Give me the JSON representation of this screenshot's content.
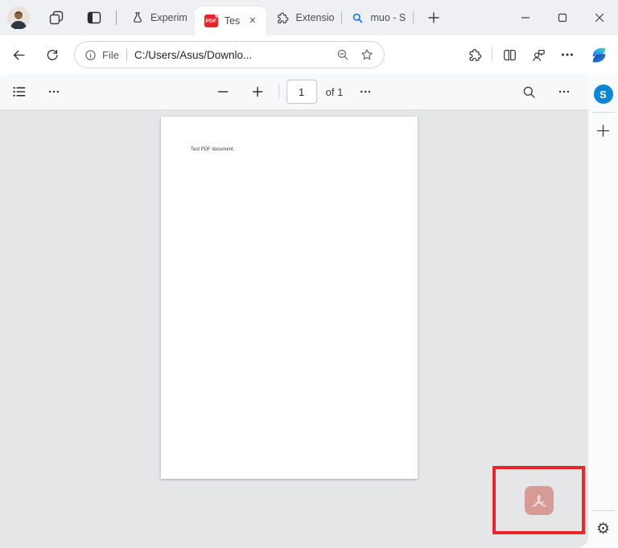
{
  "tab_strip": {
    "tabs": [
      {
        "label": "Experim"
      },
      {
        "label": "Tes"
      },
      {
        "label": "Extensio"
      },
      {
        "label": "muo - S"
      }
    ],
    "active_tab_index": 1,
    "pdf_badge": "PDF",
    "close_glyph": "✕"
  },
  "address_bar": {
    "file_label": "File",
    "url": "C:/Users/Asus/Downlo..."
  },
  "pdf_toolbar": {
    "page_number": "1",
    "page_count_label": "of 1"
  },
  "pdf_document": {
    "body_text": "Test PDF document."
  },
  "sidebar": {
    "skype_letter": "S",
    "gear_glyph": "⚙"
  },
  "annotation": {
    "highlight_color": "#e8262c"
  },
  "colors": {
    "tab_strip_bg": "#eef0f3",
    "chrome_bg": "#ffffff",
    "pdf_toolbar_bg": "#f7f8fa",
    "content_bg": "#e5e6e8",
    "pdf_icon_red": "#e5252a",
    "skype_blue": "#0a86d6",
    "search_tab_blue": "#1a73e8",
    "acrobat_button_pink": "#d79b96"
  }
}
